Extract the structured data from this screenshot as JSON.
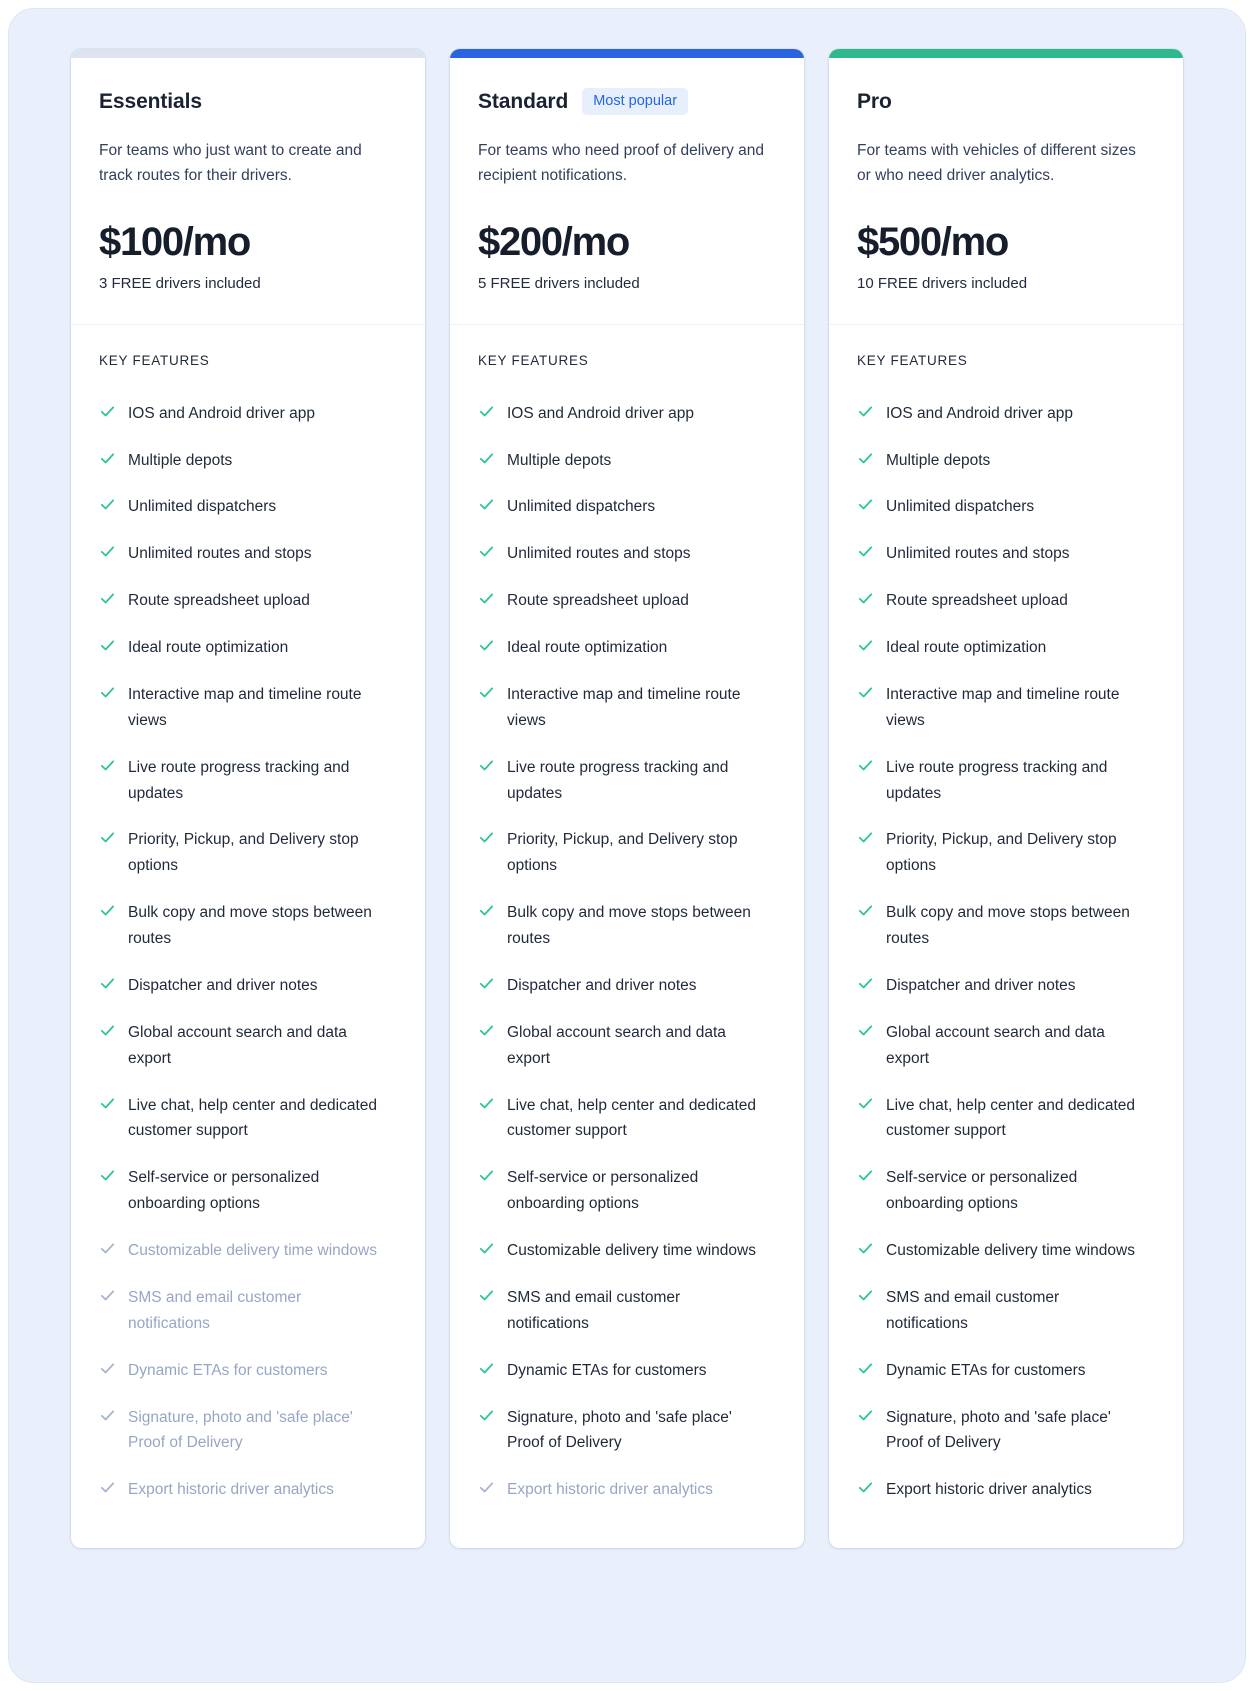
{
  "colors": {
    "page_background": "#e9f0fb",
    "card_background": "#ffffff",
    "accent_essentials": "#dde4ef",
    "accent_standard": "#2b64e0",
    "accent_pro": "#2fb88c",
    "check_enabled": "#2ec49a",
    "check_disabled": "#a7b4ce",
    "badge_text": "#2464e8",
    "badge_background": "#e7effc",
    "text_primary": "#1f2938",
    "text_disabled": "#97a6c4"
  },
  "features_heading": "KEY FEATURES",
  "plans": [
    {
      "name": "Essentials",
      "badge": null,
      "description": "For teams who just want to create and track routes for their drivers.",
      "price": "$100/mo",
      "price_note": "3 FREE drivers included",
      "accent": "#dde4ef",
      "features": [
        {
          "label": "IOS and Android driver app",
          "included": true
        },
        {
          "label": "Multiple depots",
          "included": true
        },
        {
          "label": "Unlimited dispatchers",
          "included": true
        },
        {
          "label": "Unlimited routes and stops",
          "included": true
        },
        {
          "label": "Route spreadsheet upload",
          "included": true
        },
        {
          "label": "Ideal route optimization",
          "included": true
        },
        {
          "label": "Interactive map and timeline route views",
          "included": true
        },
        {
          "label": "Live route progress tracking and updates",
          "included": true
        },
        {
          "label": "Priority, Pickup, and Delivery stop options",
          "included": true
        },
        {
          "label": "Bulk copy and move stops between routes",
          "included": true
        },
        {
          "label": "Dispatcher and driver notes",
          "included": true
        },
        {
          "label": "Global account search and data export",
          "included": true
        },
        {
          "label": "Live chat, help center and dedicated customer support",
          "included": true
        },
        {
          "label": "Self-service or personalized onboarding options",
          "included": true
        },
        {
          "label": "Customizable delivery time windows",
          "included": false
        },
        {
          "label": "SMS and email customer notifications",
          "included": false
        },
        {
          "label": "Dynamic ETAs for customers",
          "included": false
        },
        {
          "label": "Signature, photo and 'safe place' Proof of Delivery",
          "included": false
        },
        {
          "label": "Export historic driver analytics",
          "included": false
        }
      ]
    },
    {
      "name": "Standard",
      "badge": "Most popular",
      "description": "For teams who need proof of delivery and recipient notifications.",
      "price": "$200/mo",
      "price_note": "5 FREE drivers included",
      "accent": "#2b64e0",
      "features": [
        {
          "label": "IOS and Android driver app",
          "included": true
        },
        {
          "label": "Multiple depots",
          "included": true
        },
        {
          "label": "Unlimited dispatchers",
          "included": true
        },
        {
          "label": "Unlimited routes and stops",
          "included": true
        },
        {
          "label": "Route spreadsheet upload",
          "included": true
        },
        {
          "label": "Ideal route optimization",
          "included": true
        },
        {
          "label": "Interactive map and timeline route views",
          "included": true
        },
        {
          "label": "Live route progress tracking and updates",
          "included": true
        },
        {
          "label": "Priority, Pickup, and Delivery stop options",
          "included": true
        },
        {
          "label": "Bulk copy and move stops between routes",
          "included": true
        },
        {
          "label": "Dispatcher and driver notes",
          "included": true
        },
        {
          "label": "Global account search and data export",
          "included": true
        },
        {
          "label": "Live chat, help center and dedicated customer support",
          "included": true
        },
        {
          "label": "Self-service or personalized onboarding options",
          "included": true
        },
        {
          "label": "Customizable delivery time windows",
          "included": true
        },
        {
          "label": "SMS and email customer notifications",
          "included": true
        },
        {
          "label": "Dynamic ETAs for customers",
          "included": true
        },
        {
          "label": "Signature, photo and 'safe place' Proof of Delivery",
          "included": true
        },
        {
          "label": "Export historic driver analytics",
          "included": false
        }
      ]
    },
    {
      "name": "Pro",
      "badge": null,
      "description": "For teams with vehicles of different sizes or who need driver analytics.",
      "price": "$500/mo",
      "price_note": "10 FREE drivers included",
      "accent": "#2fb88c",
      "features": [
        {
          "label": "IOS and Android driver app",
          "included": true
        },
        {
          "label": "Multiple depots",
          "included": true
        },
        {
          "label": "Unlimited dispatchers",
          "included": true
        },
        {
          "label": "Unlimited routes and stops",
          "included": true
        },
        {
          "label": "Route spreadsheet upload",
          "included": true
        },
        {
          "label": "Ideal route optimization",
          "included": true
        },
        {
          "label": "Interactive map and timeline route views",
          "included": true
        },
        {
          "label": "Live route progress tracking and updates",
          "included": true
        },
        {
          "label": "Priority, Pickup, and Delivery stop options",
          "included": true
        },
        {
          "label": "Bulk copy and move stops between routes",
          "included": true
        },
        {
          "label": "Dispatcher and driver notes",
          "included": true
        },
        {
          "label": "Global account search and data export",
          "included": true
        },
        {
          "label": "Live chat, help center and dedicated customer support",
          "included": true
        },
        {
          "label": "Self-service or personalized onboarding options",
          "included": true
        },
        {
          "label": "Customizable delivery time windows",
          "included": true
        },
        {
          "label": "SMS and email customer notifications",
          "included": true
        },
        {
          "label": "Dynamic ETAs for customers",
          "included": true
        },
        {
          "label": "Signature, photo and 'safe place' Proof of Delivery",
          "included": true
        },
        {
          "label": "Export historic driver analytics",
          "included": true
        }
      ]
    }
  ]
}
